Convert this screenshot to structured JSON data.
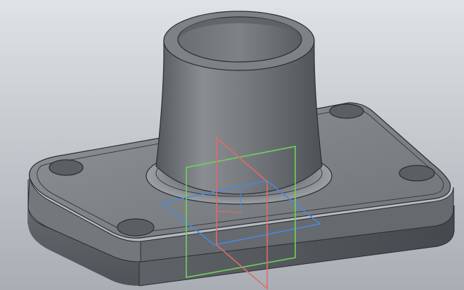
{
  "viewport": {
    "background": "#d7dbe0",
    "background_bottom": "#a8aeb4"
  },
  "model": {
    "body_color": "#8a8e92",
    "edge_color": "#2b2d30"
  },
  "planes": {
    "front_color": "#e06a6a",
    "right_color": "#6fd35a",
    "top_color": "#4a86e0"
  }
}
